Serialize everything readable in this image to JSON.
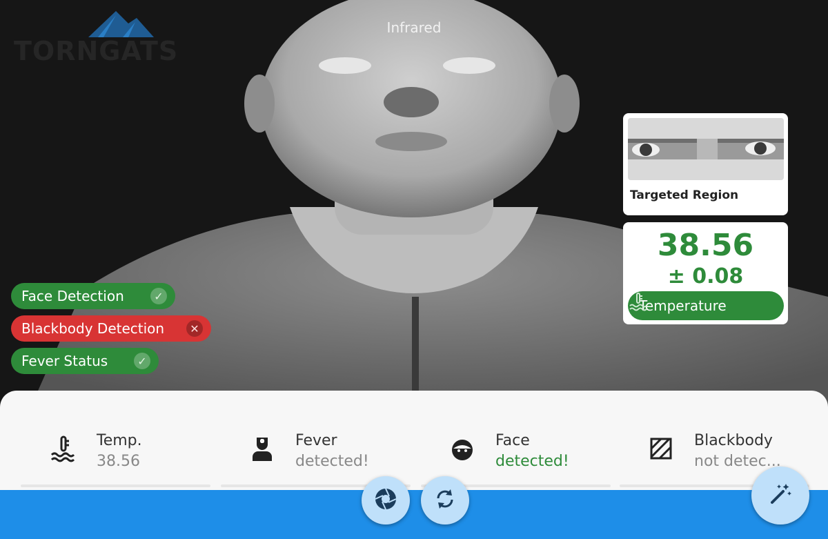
{
  "camera": {
    "title": "Infrared",
    "logo_text": "TORNGATS"
  },
  "status_pills": [
    {
      "label": "Face Detection",
      "state": "ok",
      "icon": "check-circle-icon"
    },
    {
      "label": "Blackbody Detection",
      "state": "error",
      "icon": "x-circle-icon"
    },
    {
      "label": "Fever Status",
      "state": "ok",
      "icon": "check-circle-icon"
    }
  ],
  "region_card": {
    "title": "Targeted Region"
  },
  "temperature_card": {
    "value": "38.56",
    "accuracy": "± 0.08",
    "label": "Temperature",
    "icon": "thermometer-icon"
  },
  "stats": [
    {
      "title": "Temp.",
      "value": "38.56",
      "icon": "thermometer-icon",
      "value_color": "gray"
    },
    {
      "title": "Fever",
      "value": "detected!",
      "icon": "nurse-icon",
      "value_color": "gray"
    },
    {
      "title": "Face",
      "value": "detected!",
      "icon": "face-icon",
      "value_color": "green"
    },
    {
      "title": "Blackbody",
      "value": "not detec...",
      "icon": "hatch-square-icon",
      "value_color": "gray"
    }
  ],
  "buttons": {
    "capture_icon": "camera-shutter-icon",
    "switch_icon": "refresh-icon",
    "auto_icon": "magic-wand-icon"
  },
  "colors": {
    "ok": "#2e8b3a",
    "error": "#d83434",
    "bar": "#1e8ee8",
    "fab": "#bfe0fa"
  }
}
